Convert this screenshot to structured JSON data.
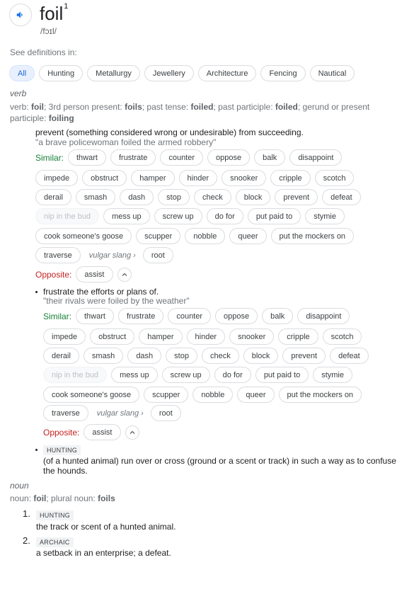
{
  "header": {
    "word": "foil",
    "superscript": "1",
    "phonetic": "/fɔɪl/"
  },
  "see_defs": {
    "label": "See definitions in:",
    "chips": [
      "All",
      "Hunting",
      "Metallurgy",
      "Jewellery",
      "Architecture",
      "Fencing",
      "Nautical"
    ]
  },
  "verb": {
    "pos": "verb",
    "forms": {
      "p1": "verb: ",
      "b1": "foil",
      "p2": "; 3rd person present: ",
      "b2": "foils",
      "p3": "; past tense: ",
      "b3": "foiled",
      "p4": "; past participle: ",
      "b4": "foiled",
      "p5": "; gerund or present participle: ",
      "b5": "foiling"
    },
    "sense1": {
      "definition": "prevent (something considered wrong or undesirable) from succeeding.",
      "example": "\"a brave policewoman foiled the armed robbery\"",
      "similar_label": "Similar:",
      "similar": [
        "thwart",
        "frustrate",
        "counter",
        "oppose",
        "balk",
        "disappoint",
        "impede",
        "obstruct",
        "hamper",
        "hinder",
        "snooker",
        "cripple",
        "scotch",
        "derail",
        "smash",
        "dash",
        "stop",
        "check",
        "block",
        "prevent",
        "defeat",
        "nip in the bud",
        "mess up",
        "screw up",
        "do for",
        "put paid to",
        "stymie",
        "cook someone's goose",
        "scupper",
        "nobble",
        "queer",
        "put the mockers on",
        "traverse"
      ],
      "vulgar_slang": "vulgar slang",
      "after_slang": "root",
      "opposite_label": "Opposite:",
      "opposite": "assist"
    },
    "sense2": {
      "definition": "frustrate the efforts or plans of.",
      "example": "\"their rivals were foiled by the weather\"",
      "similar_label": "Similar:",
      "vulgar_slang": "vulgar slang",
      "after_slang": "root",
      "opposite_label": "Opposite:",
      "opposite": "assist"
    },
    "sense3": {
      "tag": "HUNTING",
      "definition": "(of a hunted animal) run over or cross (ground or a scent or track) in such a way as to confuse the hounds."
    }
  },
  "noun": {
    "pos": "noun",
    "forms": {
      "p1": "noun: ",
      "b1": "foil",
      "p2": "; plural noun: ",
      "b2": "foils"
    },
    "senses": [
      {
        "num": "1.",
        "tag": "HUNTING",
        "definition": "the track or scent of a hunted animal."
      },
      {
        "num": "2.",
        "tag": "ARCHAIC",
        "definition": "a setback in an enterprise; a defeat."
      }
    ]
  },
  "icons": {
    "speaker": "speaker-icon",
    "chevron": "chevron-up-icon",
    "slang_arrow": "chevron-right-icon"
  },
  "colors": {
    "similar": "#188038",
    "opposite": "#c5221f",
    "selected_chip": "#1967d2"
  }
}
